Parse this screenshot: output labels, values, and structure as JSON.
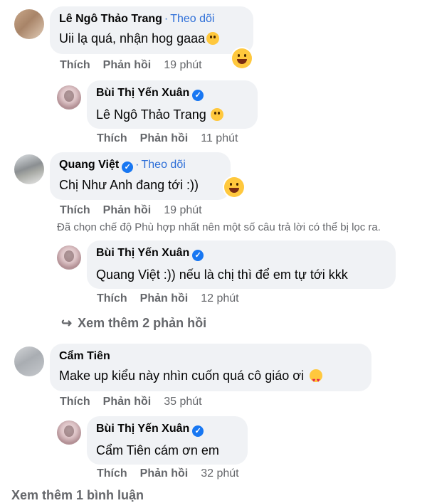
{
  "comments": [
    {
      "author": "Lê Ngô Thảo Trang",
      "follow": "Theo dõi",
      "text": "Uii lạ quá, nhận hog gaaa",
      "actions": {
        "like": "Thích",
        "reply": "Phản hồi",
        "time": "19 phút"
      }
    },
    {
      "author": "Bùi Thị Yến Xuân",
      "mention": "Lê Ngô Thảo Trang",
      "text": "",
      "actions": {
        "like": "Thích",
        "reply": "Phản hồi",
        "time": "11 phút"
      }
    },
    {
      "author": "Quang Việt",
      "follow": "Theo dõi",
      "text": "Chị Như Anh đang tới :))",
      "actions": {
        "like": "Thích",
        "reply": "Phản hồi",
        "time": "19 phút"
      }
    },
    {
      "author": "Bùi Thị Yến Xuân",
      "mention": "Quang Việt",
      "text": ":)) nếu là chị thì để em tự tới kkk",
      "actions": {
        "like": "Thích",
        "reply": "Phản hồi",
        "time": "12 phút"
      }
    },
    {
      "author": "Cẩm Tiên",
      "text": "Make up kiểu này nhìn cuốn quá cô giáo ơi",
      "actions": {
        "like": "Thích",
        "reply": "Phản hồi",
        "time": "35 phút"
      }
    },
    {
      "author": "Bùi Thị Yến Xuân",
      "mention": "Cẩm Tiên",
      "text": "cám ơn em",
      "actions": {
        "like": "Thích",
        "reply": "Phản hồi",
        "time": "32 phút"
      }
    }
  ],
  "filter_note": "Đã chọn chế độ Phù hợp nhất nên một số câu trả lời có thể bị lọc ra.",
  "view_more_replies": "Xem thêm 2 phản hồi",
  "view_more_bottom": "Xem thêm 1 bình luận",
  "verified_icon": "✓",
  "reply_arrow_icon": "↪",
  "colors": {
    "link": "#2e6fd8",
    "verified": "#1877f2",
    "bubble": "#f0f2f5",
    "meta": "#65676b"
  }
}
